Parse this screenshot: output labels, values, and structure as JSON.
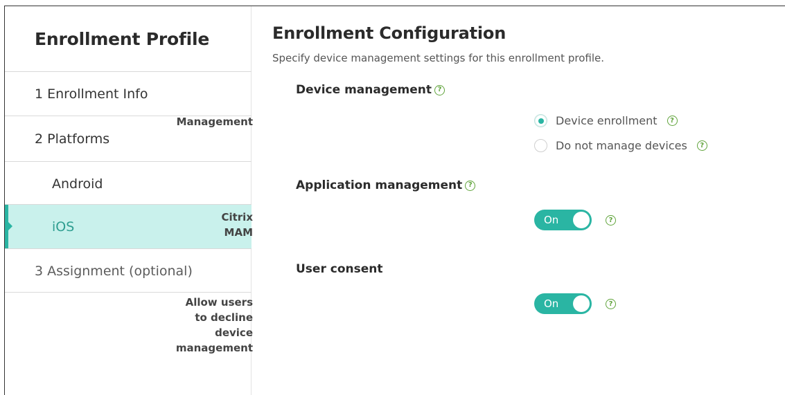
{
  "sidebar": {
    "title": "Enrollment Profile",
    "items": [
      {
        "number": "1",
        "label": "1  Enrollment Info"
      },
      {
        "number": "2",
        "label": "2  Platforms"
      },
      {
        "label": "Android"
      },
      {
        "label": "iOS"
      },
      {
        "number": "3",
        "label": "3  Assignment (optional)"
      }
    ]
  },
  "main": {
    "title": "Enrollment Configuration",
    "subtitle": "Specify device management settings for this enrollment profile.",
    "device_management": {
      "title": "Device management",
      "field_label": "Management",
      "options": [
        {
          "label": "Device enrollment",
          "selected": true
        },
        {
          "label": "Do not manage devices",
          "selected": false
        }
      ]
    },
    "application_management": {
      "title": "Application management",
      "field_label": "Citrix MAM",
      "toggle": "On"
    },
    "user_consent": {
      "title": "User consent",
      "field_label_line1": "Allow users to decline device",
      "field_label_line2": "management",
      "toggle": "On"
    },
    "help_glyph": "?"
  },
  "colors": {
    "accent": "#2ab5a3",
    "active_bg": "#c9f1ec",
    "help": "#5fa33a"
  }
}
